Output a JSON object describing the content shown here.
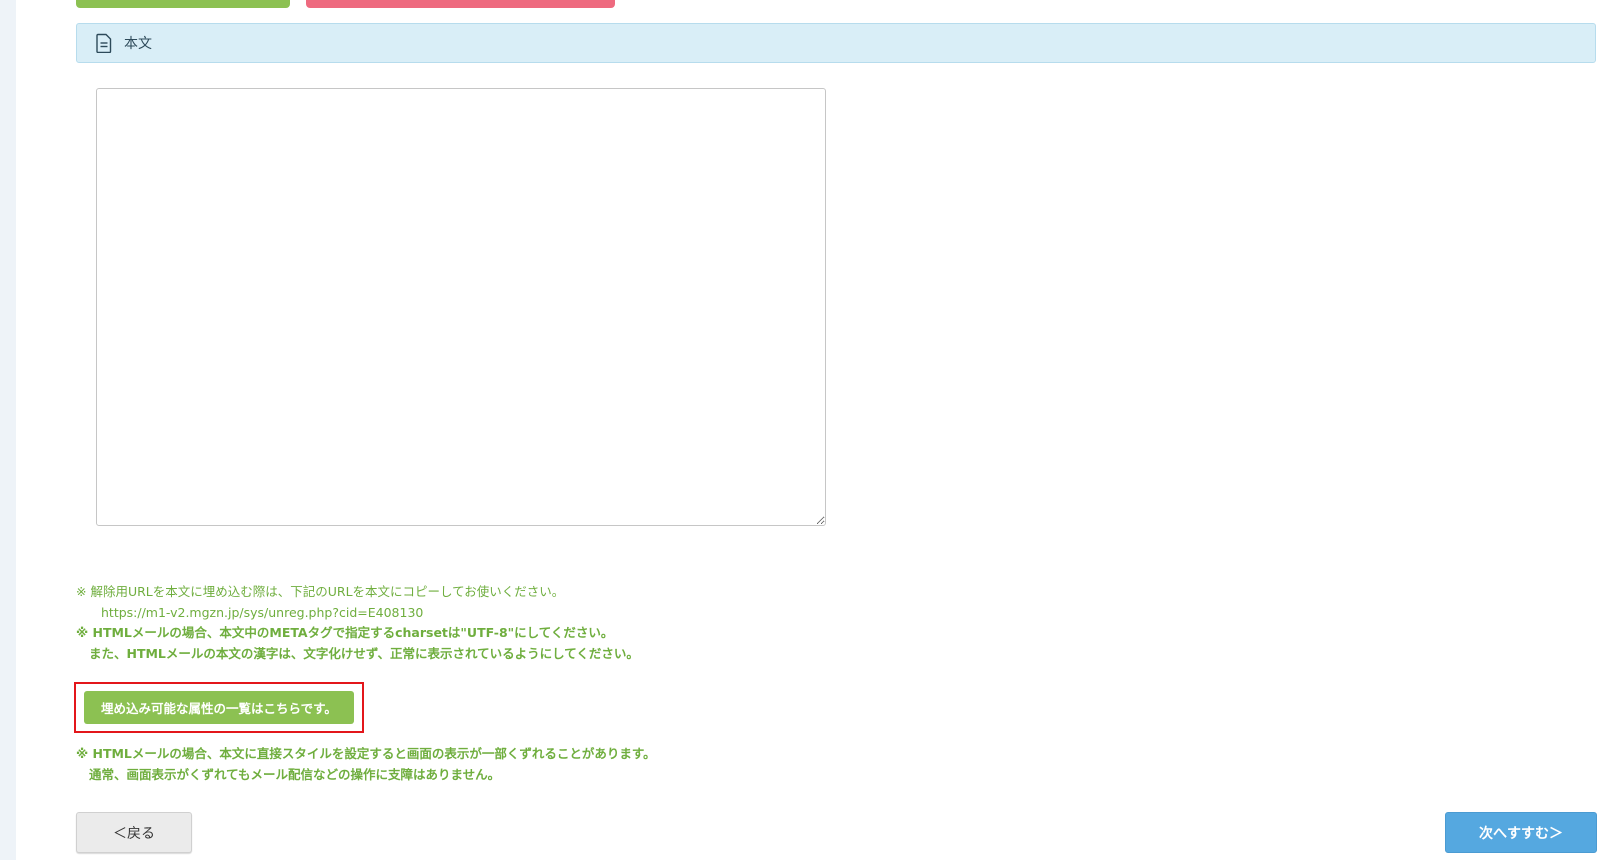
{
  "colors": {
    "accent_green": "#8cc152",
    "accent_pink": "#ee6a7f",
    "accent_blue": "#55a8e0",
    "note_green": "#6fae3e",
    "highlight_red": "#e3161b"
  },
  "section": {
    "title": "本文",
    "icon": "document-icon"
  },
  "body_field": {
    "value": ""
  },
  "notes": {
    "unsubscribe_note": "※ 解除用URLを本文に埋め込む際は、下記のURLを本文にコピーしてお使いください。",
    "unsubscribe_url": "https://m1-v2.mgzn.jp/sys/unreg.php?cid=E408130",
    "html_charset_note": "※ HTMLメールの場合、本文中のMETAタグで指定するcharsetは\"UTF-8\"にしてください。",
    "html_charset_note_2": "また、HTMLメールの本文の漢字は、文字化けせず、正常に表示されているようにしてください。"
  },
  "attributes_button": {
    "label": "埋め込み可能な属性の一覧はこちらです。"
  },
  "style_notes": {
    "line1": "※ HTMLメールの場合、本文に直接スタイルを設定すると画面の表示が一部くずれることがあります。",
    "line2": "通常、画面表示がくずれてもメール配信などの操作に支障はありません。"
  },
  "nav": {
    "back_label": "＜戻る",
    "next_label": "次へすすむ＞"
  }
}
